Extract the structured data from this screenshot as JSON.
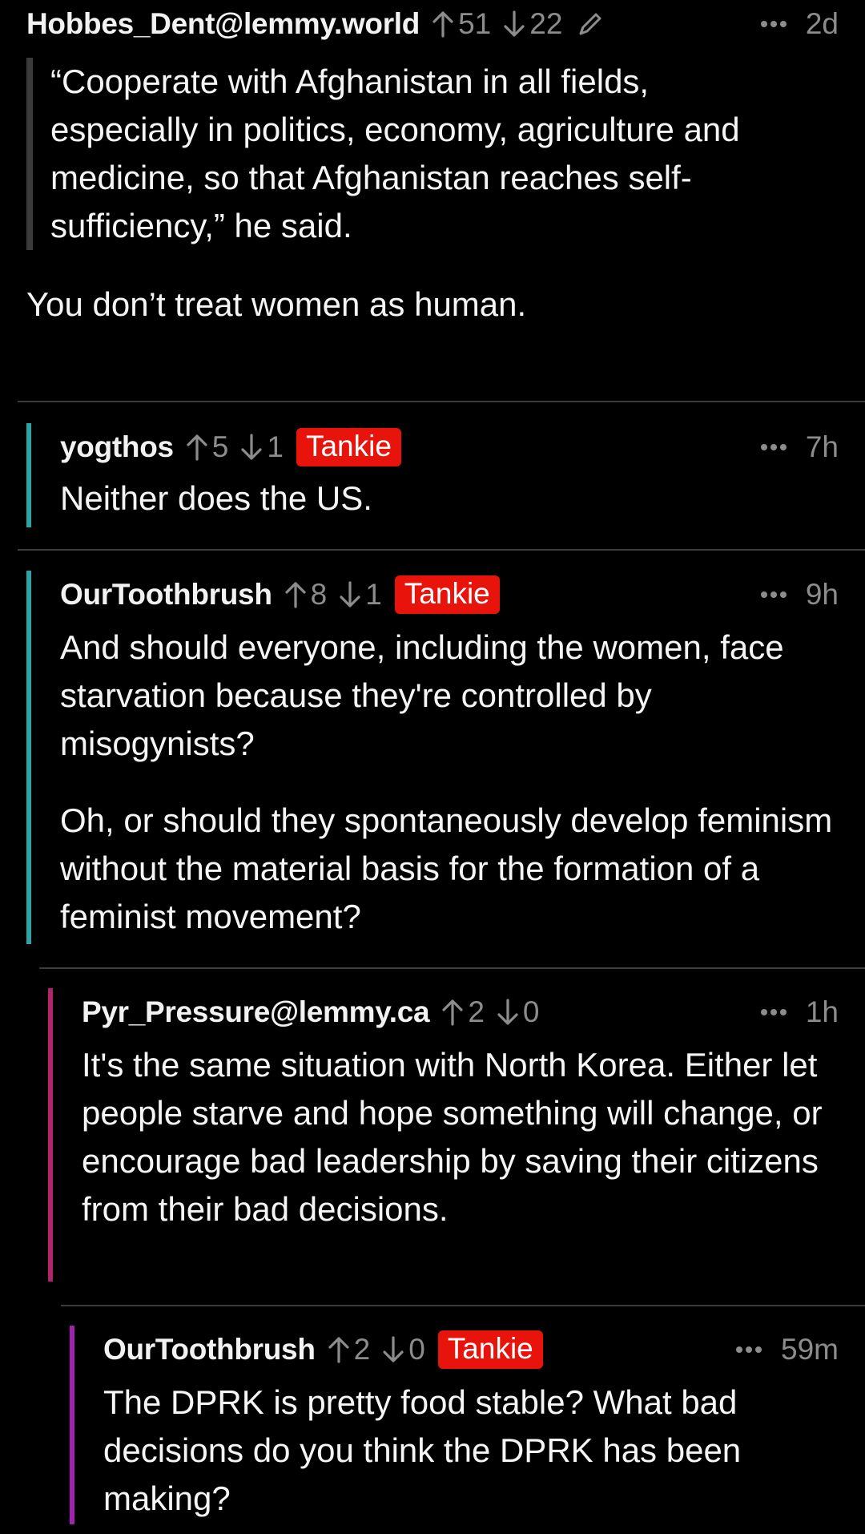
{
  "comments": [
    {
      "username": "Hobbes_Dent@lemmy.world",
      "upvotes": "51",
      "downvotes": "22",
      "time": "2d",
      "quote": "“Cooperate with Afghanistan in all fields, especially in politics, economy, agriculture and medicine, so that Afghanistan reaches self-sufficiency,” he said.",
      "body": [
        "You don’t treat women as human."
      ]
    },
    {
      "username": "yogthos",
      "upvotes": "5",
      "downvotes": "1",
      "badge": "Tankie",
      "time": "7h",
      "body": [
        "Neither does the US."
      ],
      "bar_color": "#2aa5a5"
    },
    {
      "username": "OurToothbrush",
      "upvotes": "8",
      "downvotes": "1",
      "badge": "Tankie",
      "time": "9h",
      "body": [
        "And should everyone, including the women, face starvation because they're controlled by misogynists?",
        "Oh, or should they spontaneously develop feminism without the material basis for the formation of a feminist movement?"
      ],
      "bar_color": "#2aa5a5"
    },
    {
      "username": "Pyr_Pressure@lemmy.ca",
      "upvotes": "2",
      "downvotes": "0",
      "time": "1h",
      "body": [
        "It's the same situation with North Korea. Either let people starve and hope something will change, or encourage bad leadership by saving their citizens from their bad decisions."
      ],
      "bar_color": "#b0256a"
    },
    {
      "username": "OurToothbrush",
      "upvotes": "2",
      "downvotes": "0",
      "badge": "Tankie",
      "time": "59m",
      "body": [
        "The DPRK is pretty food stable? What bad decisions do you think the DPRK has been making?"
      ],
      "bar_color": "#a020b0"
    }
  ],
  "colors": {
    "background": "#000000",
    "badge": "#e8140c",
    "meta": "#8c8c8c",
    "divider": "#3c3c3c"
  },
  "icons": {
    "upvote": "arrow-up-icon",
    "downvote": "arrow-down-icon",
    "edit": "pencil-icon",
    "more": "more-dots-icon"
  }
}
